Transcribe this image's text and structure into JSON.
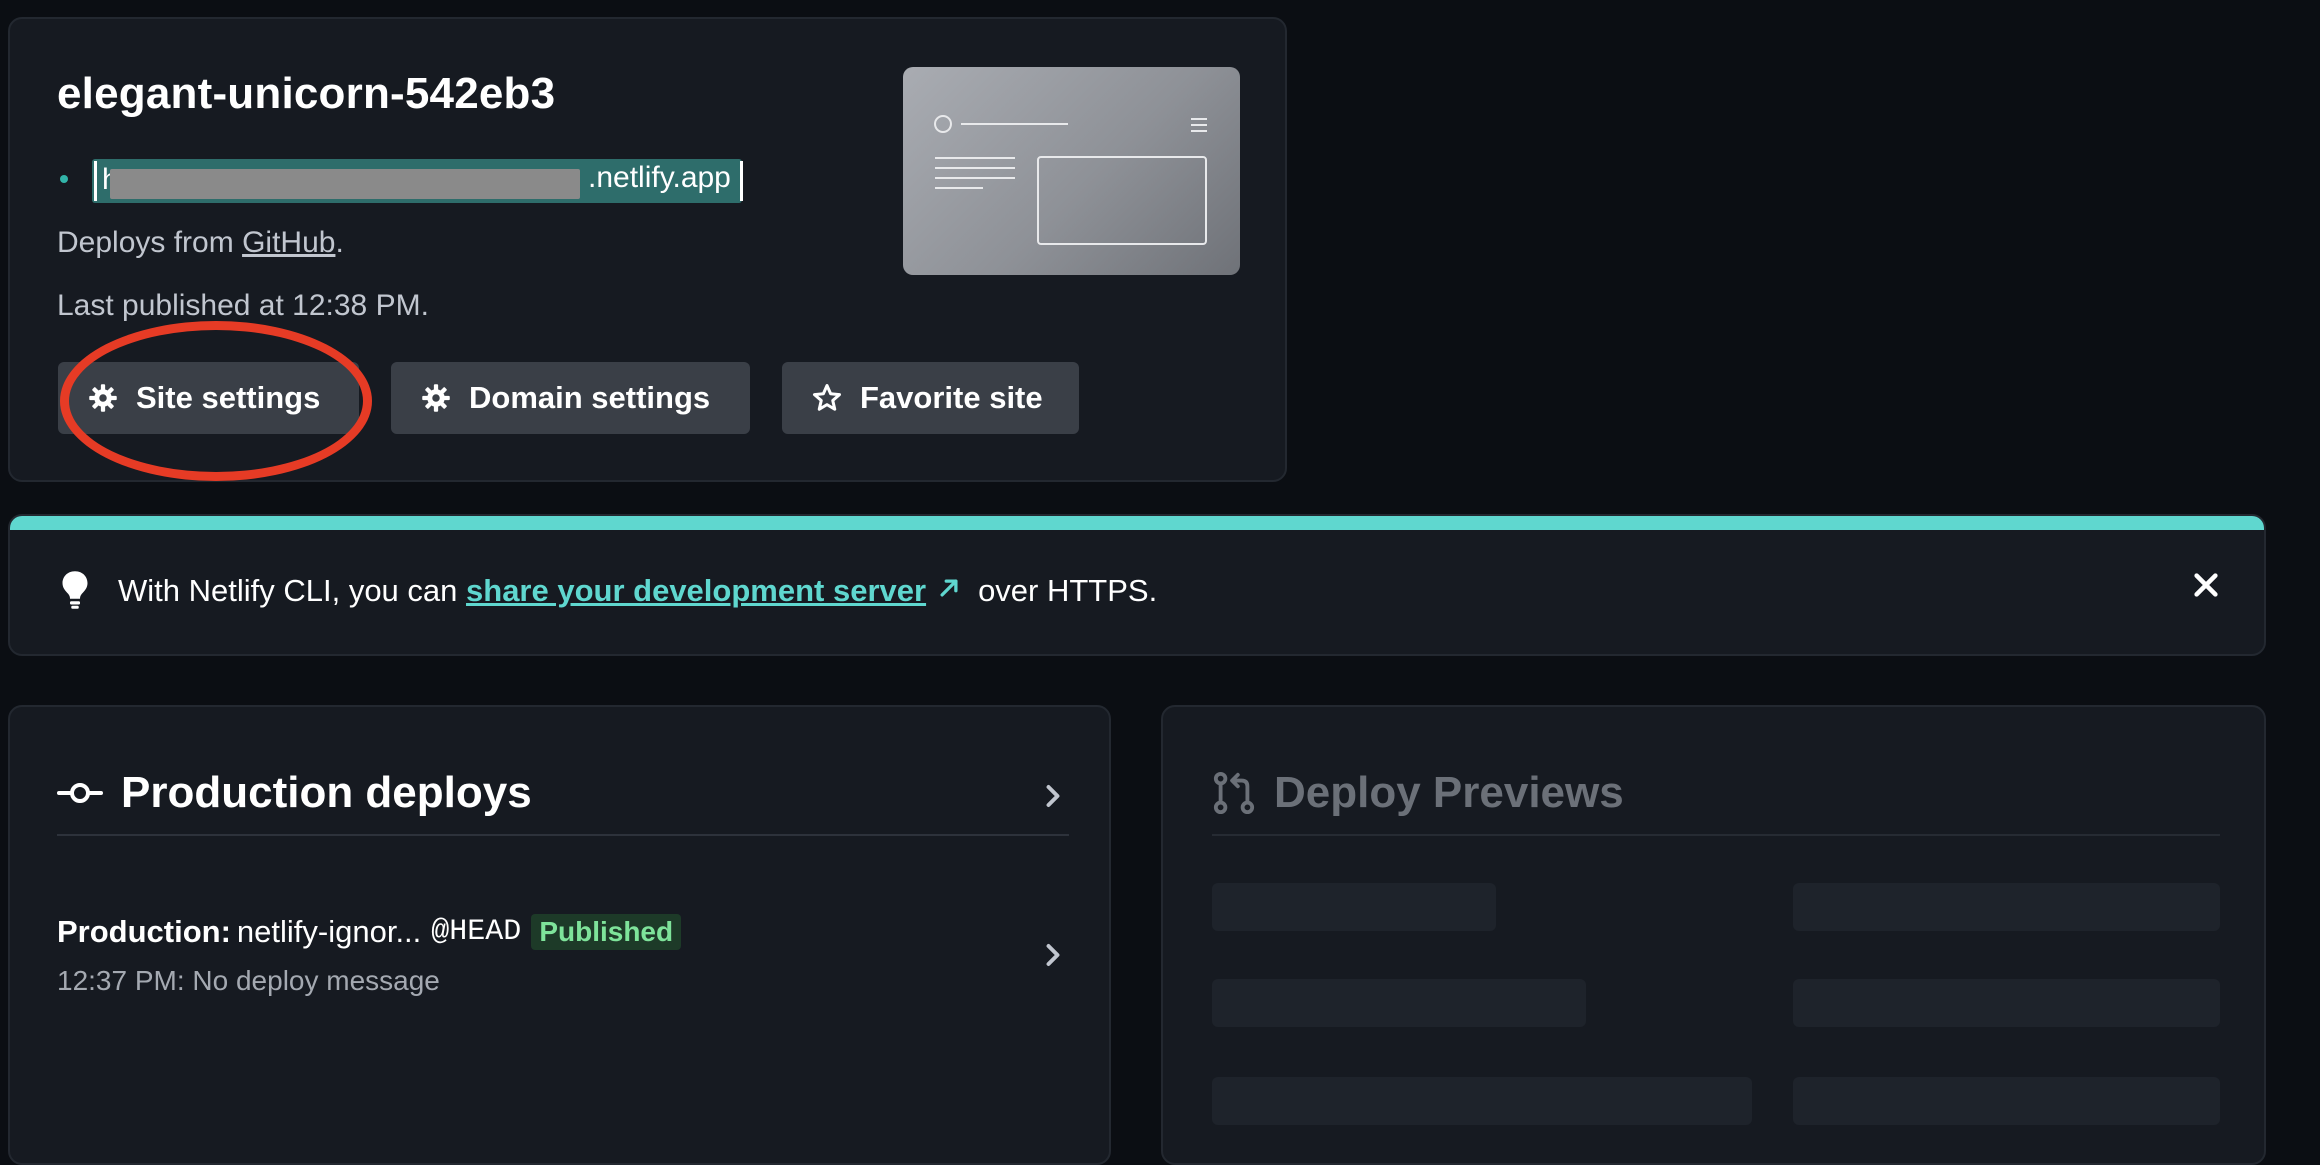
{
  "site": {
    "name": "elegant-unicorn-542eb3",
    "url_visible_prefix": "h",
    "url_visible_suffix": ".netlify.app",
    "deploys_from_label": "Deploys from ",
    "deploys_from_source": "GitHub",
    "deploys_from_end": ".",
    "last_published": "Last published at 12:38 PM.",
    "buttons": {
      "site_settings": "Site settings",
      "domain_settings": "Domain settings",
      "favorite_site": "Favorite site"
    }
  },
  "banner": {
    "text_before": "With Netlify CLI, you can ",
    "link_text": "share your development server",
    "text_after": "over HTTPS.",
    "accent_color": "#5fd7cf"
  },
  "production": {
    "title": "Production deploys",
    "deploy": {
      "prefix": "Production: ",
      "branch": "netlify-ignor...",
      "ref": "@HEAD",
      "status": "Published",
      "subtitle": "12:37 PM: No deploy message"
    }
  },
  "previews": {
    "title": "Deploy Previews"
  },
  "colors": {
    "background": "#0b0e13",
    "card": "#161a21",
    "button": "#3a3f47",
    "highlight_oval": "#e63b25",
    "published_badge": "#7ee39a"
  },
  "icons": {
    "gear": "gear-icon",
    "star": "star-outline-icon",
    "bulb": "lightbulb-icon",
    "external": "external-link-arrow-icon",
    "close": "close-icon",
    "commit": "git-commit-icon",
    "pull": "git-pull-request-icon",
    "chevron": "chevron-right-icon"
  }
}
